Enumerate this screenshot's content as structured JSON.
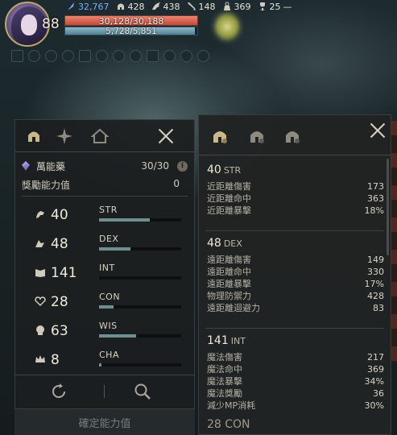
{
  "hud": {
    "level": "88",
    "stats": [
      {
        "icon": "feather-icon",
        "value": "32,767",
        "color": "#6fb2ff"
      },
      {
        "icon": "helmet-icon",
        "value": "428"
      },
      {
        "icon": "wing-icon",
        "value": "438"
      },
      {
        "icon": "sword-icon",
        "value": "148"
      },
      {
        "icon": "weight-icon",
        "value": "369"
      },
      {
        "icon": "trophy-icon",
        "value": "25"
      }
    ],
    "trophy_suffix": "—",
    "hp_text": "30,128/30,188",
    "hp_fraction": 0.998,
    "mp_text": "5,728/5,851",
    "mp_fraction": 0.979,
    "buff_count": 12
  },
  "left": {
    "potion_label": "萬能藥",
    "potion_count": "30/30",
    "info_mark": "i",
    "bonus_label": "獎勵能力值",
    "bonus_value": "0",
    "stats": [
      {
        "icon": "strength-icon",
        "value": "40",
        "name": "STR",
        "fill": 0.62
      },
      {
        "icon": "dexterity-icon",
        "value": "48",
        "name": "DEX",
        "fill": 0.38
      },
      {
        "icon": "intellect-icon",
        "value": "141",
        "name": "INT",
        "fill": 0.0
      },
      {
        "icon": "constitution-icon",
        "value": "28",
        "name": "CON",
        "fill": 0.18
      },
      {
        "icon": "wisdom-icon",
        "value": "63",
        "name": "WIS",
        "fill": 0.45
      },
      {
        "icon": "charisma-icon",
        "value": "8",
        "name": "CHA",
        "fill": 0.03
      }
    ],
    "confirm_label": "確定能力值"
  },
  "right": {
    "sections": [
      {
        "value": "40",
        "tag": "STR",
        "lines": [
          {
            "label": "近距離傷害",
            "value": "173"
          },
          {
            "label": "近距離命中",
            "value": "363"
          },
          {
            "label": "近距離暴擊",
            "value": "18%"
          }
        ]
      },
      {
        "value": "48",
        "tag": "DEX",
        "lines": [
          {
            "label": "遠距離傷害",
            "value": "149"
          },
          {
            "label": "遠距離命中",
            "value": "330"
          },
          {
            "label": "遠距離暴擊",
            "value": "17%"
          },
          {
            "label": "物理防禦力",
            "value": "428"
          },
          {
            "label": "遠距離迴避力",
            "value": "83"
          }
        ]
      },
      {
        "value": "141",
        "tag": "INT",
        "lines": [
          {
            "label": "魔法傷害",
            "value": "217"
          },
          {
            "label": "魔法命中",
            "value": "369"
          },
          {
            "label": "魔法暴擊",
            "value": "34%"
          },
          {
            "label": "魔法獎勵",
            "value": "36"
          },
          {
            "label": "減少MP消耗",
            "value": "30%"
          }
        ]
      }
    ],
    "footer_partial": "28 CON"
  }
}
